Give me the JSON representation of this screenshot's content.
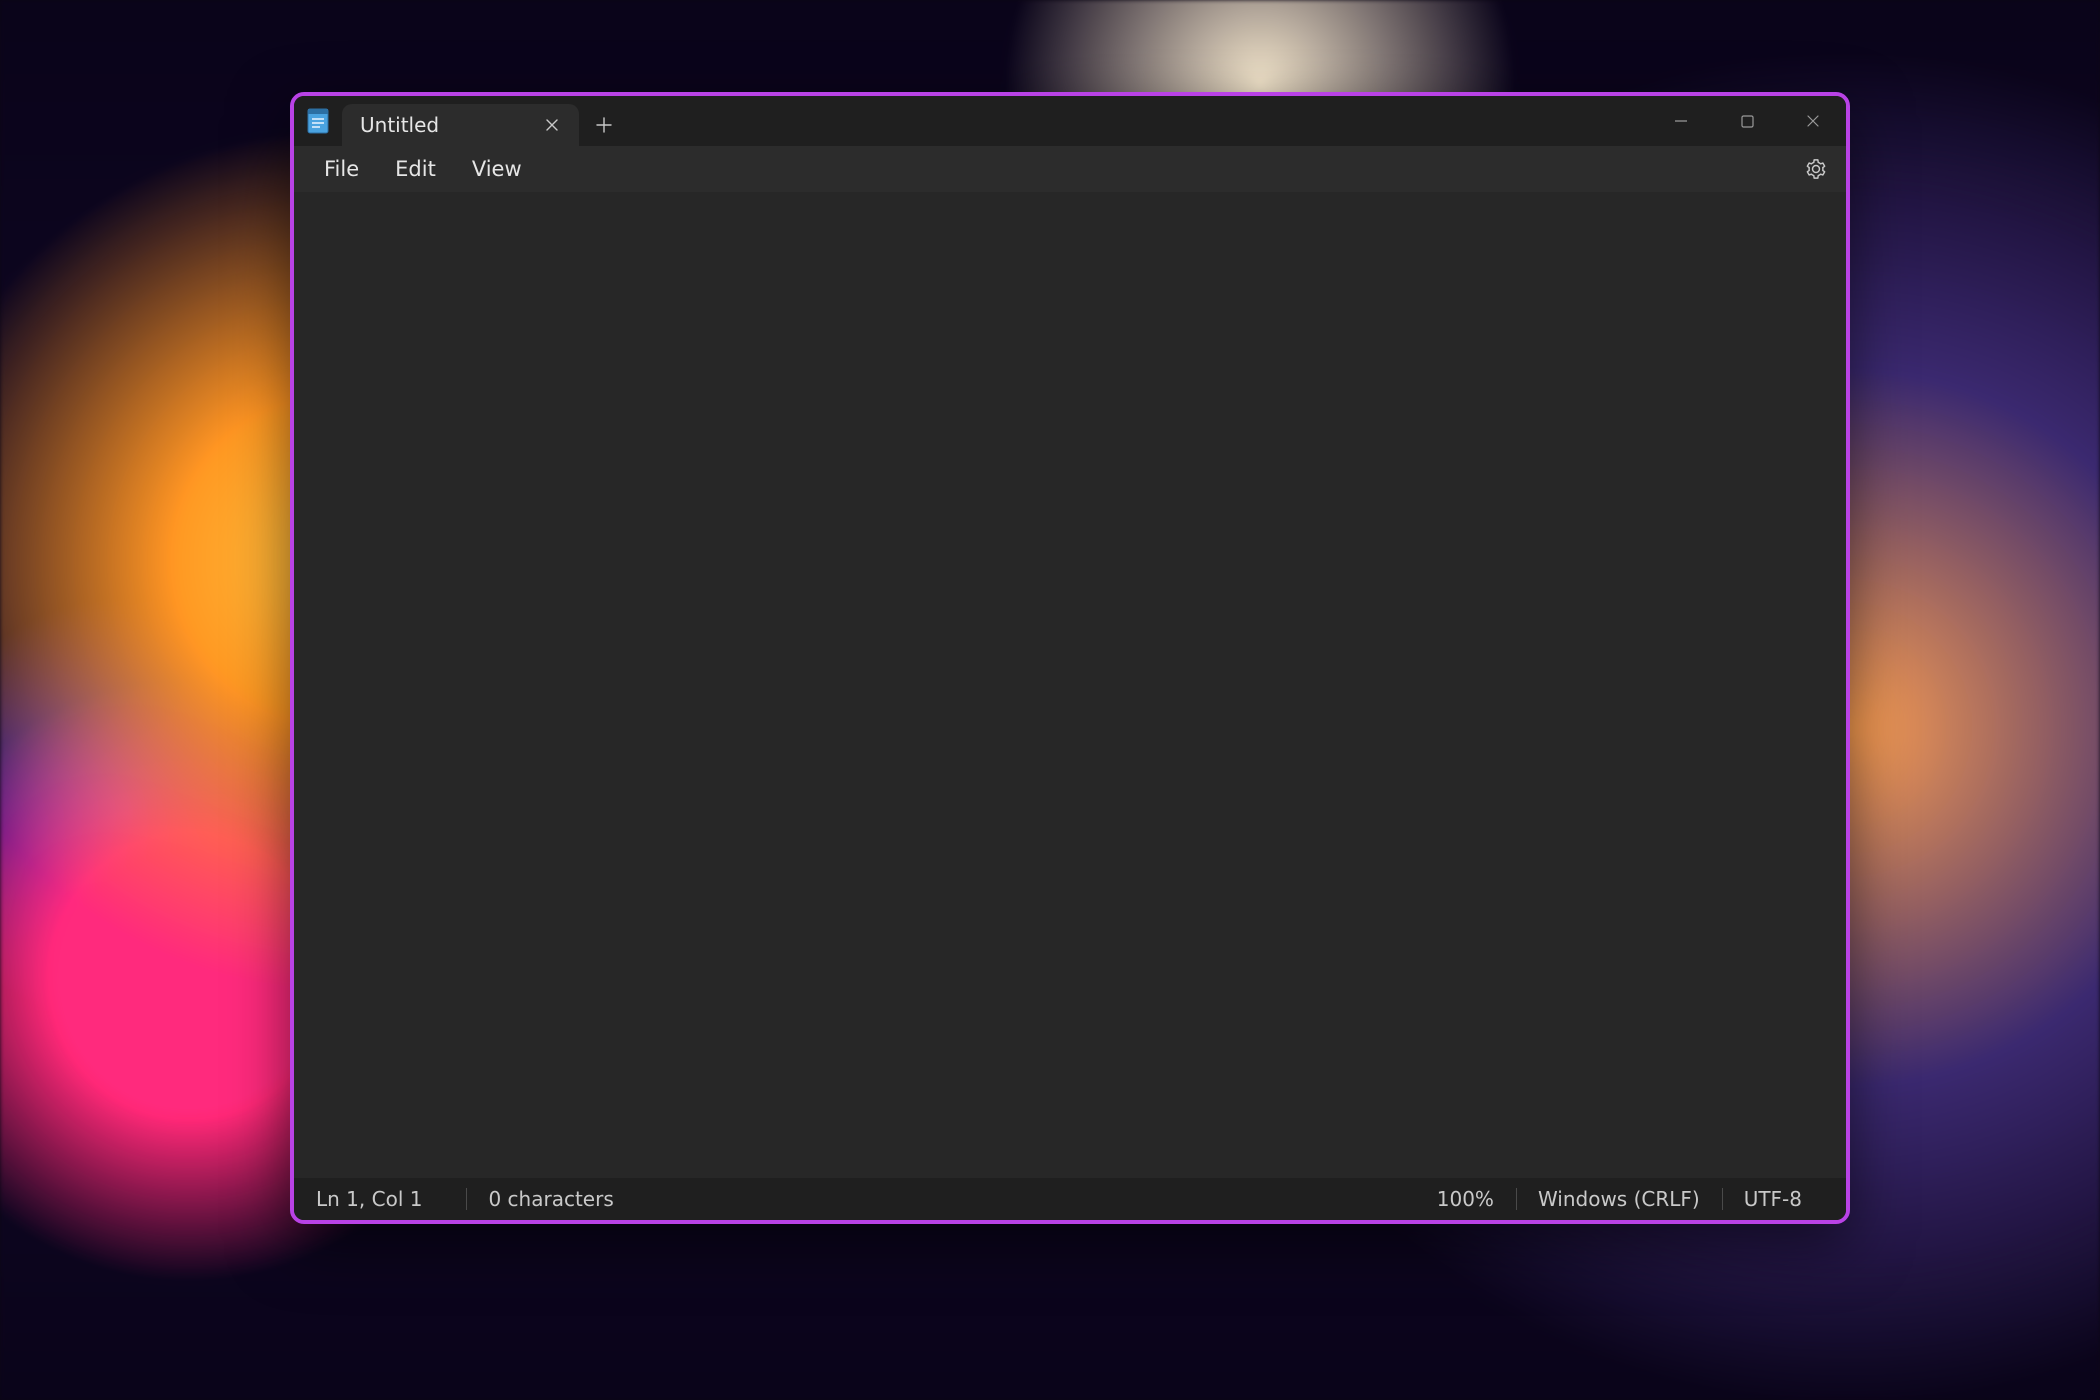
{
  "colors": {
    "accent": "#b942e6"
  },
  "titlebar": {
    "tab": {
      "label": "Untitled"
    }
  },
  "menubar": {
    "items": [
      "File",
      "Edit",
      "View"
    ]
  },
  "editor": {
    "content": ""
  },
  "statusbar": {
    "position": "Ln 1, Col 1",
    "char_count": "0 characters",
    "zoom": "100%",
    "line_ending": "Windows (CRLF)",
    "encoding": "UTF-8"
  }
}
